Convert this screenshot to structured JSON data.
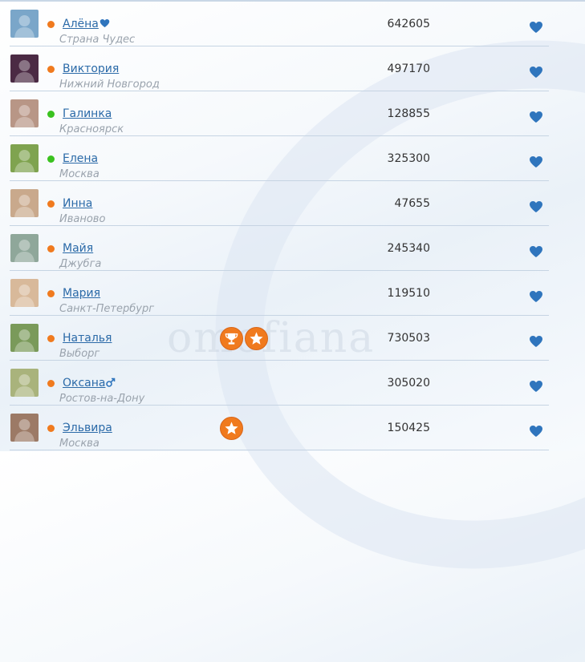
{
  "accent_color": "#2b6aa8",
  "status_colors": {
    "online": "#3ac21f",
    "away": "#f07a1e"
  },
  "watermark": "omofiana",
  "rows": [
    {
      "name": "Алёна",
      "name_icon": "heart-icon",
      "city": "Страна Чудес",
      "score": "642605",
      "status": "orange",
      "avatar_color": "#7aa6c9"
    },
    {
      "name": "Виктория",
      "city": "Нижний Новгород",
      "score": "497170",
      "status": "orange",
      "avatar_color": "#4b2a44"
    },
    {
      "name": "Галинка",
      "city": "Красноярск",
      "score": "128855",
      "status": "green",
      "avatar_color": "#b89686"
    },
    {
      "name": "Елена",
      "city": "Москва",
      "score": "325300",
      "status": "green",
      "avatar_color": "#7fa34f"
    },
    {
      "name": "Инна",
      "city": "Иваново",
      "score": "47655",
      "status": "orange",
      "avatar_color": "#c9a98c"
    },
    {
      "name": "Майя",
      "city": "Джубга",
      "score": "245340",
      "status": "orange",
      "avatar_color": "#8fa79a"
    },
    {
      "name": "Мария",
      "city": "Санкт-Петербург",
      "score": "119510",
      "status": "orange",
      "avatar_color": "#d8b99a"
    },
    {
      "name": "Наталья",
      "city": "Выборг",
      "score": "730503",
      "status": "orange",
      "avatar_color": "#7a9a5a",
      "badges": [
        "trophy-icon",
        "star-icon"
      ]
    },
    {
      "name": "Оксана",
      "name_icon": "male-symbol-icon",
      "city": "Ростов-на-Дону",
      "score": "305020",
      "status": "orange",
      "avatar_color": "#a9b37c"
    },
    {
      "name": "Эльвира",
      "city": "Москва",
      "score": "150425",
      "status": "orange",
      "avatar_color": "#9c7a66",
      "badges": [
        "star-icon"
      ]
    }
  ]
}
